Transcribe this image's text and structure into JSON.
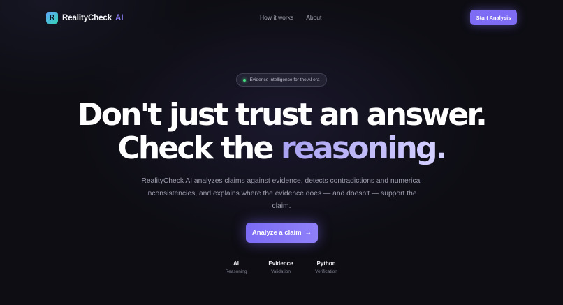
{
  "nav": {
    "brand_initial": "R",
    "brand_name": "RealityCheck",
    "brand_suffix": "AI",
    "links": [
      "How it works",
      "About"
    ],
    "cta_label": "Start Analysis"
  },
  "hero": {
    "badge": "Evidence intelligence for the AI era",
    "headline_line1": "Don't just trust an answer.",
    "headline_line2_plain": "Check the ",
    "headline_line2_accent": "reasoning.",
    "subtitle": "RealityCheck AI analyzes claims against evidence, detects contradictions and numerical inconsistencies, and explains where the evidence does — and doesn't — support the claim.",
    "cta_label": "Analyze a claim",
    "cta_arrow": "→"
  },
  "stats": [
    {
      "title": "AI",
      "subtitle": "Reasoning"
    },
    {
      "title": "Evidence",
      "subtitle": "Validation"
    },
    {
      "title": "Python",
      "subtitle": "Verification"
    }
  ],
  "colors": {
    "background": "#0d0d13",
    "accent": "#7f6cf5",
    "brand_ai": "#8b7cf6",
    "status_dot": "#4ade80"
  },
  "icons": {
    "logo": "r-logo-icon",
    "badge_dot": "status-dot-icon",
    "cta_arrow": "arrow-right-icon"
  }
}
